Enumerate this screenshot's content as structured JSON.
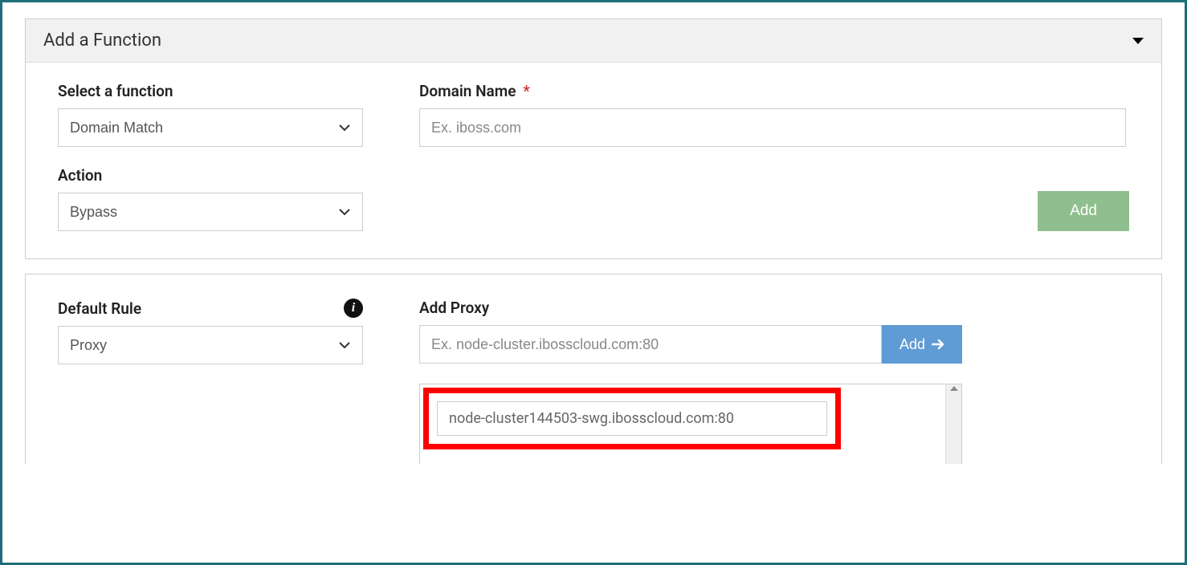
{
  "panel1": {
    "title": "Add a Function",
    "select_function": {
      "label": "Select a function",
      "value": "Domain Match"
    },
    "domain_name": {
      "label": "Domain Name",
      "placeholder": "Ex. iboss.com"
    },
    "action": {
      "label": "Action",
      "value": "Bypass"
    },
    "add_button": "Add"
  },
  "panel2": {
    "default_rule": {
      "label": "Default Rule",
      "value": "Proxy"
    },
    "add_proxy": {
      "label": "Add Proxy",
      "placeholder": "Ex. node-cluster.ibosscloud.com:80",
      "button": "Add"
    },
    "proxy_list": {
      "items": [
        "node-cluster144503-swg.ibosscloud.com:80"
      ]
    }
  }
}
